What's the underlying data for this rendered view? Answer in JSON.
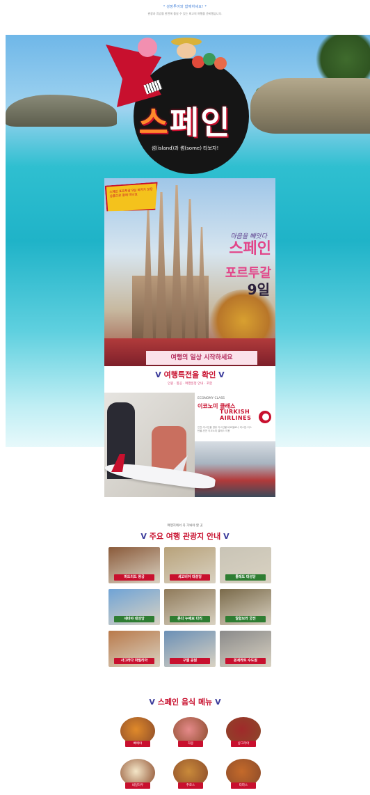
{
  "top": {
    "headline": "* 성장투어와 함께하세요! *",
    "subline": "관광과 휴양을 한번에 즐길 수 있는 최고의 여행을 준비했습니다."
  },
  "hero": {
    "title_first": "스",
    "title_rest": "페인",
    "subtitle": "섬(island)과 썸(some) 타보자!"
  },
  "poster": {
    "flag_text": "스페인 포르투갈 9일 최저가 보장 상품으로 함께 떠나요",
    "tagline": "마음을 빼앗다",
    "h1": "스페인",
    "h2": "포르투갈",
    "h3": "9일",
    "banner": "여행의 일상 시작하세요",
    "section_title": "여행특전을 확인",
    "section_small": "인원 · 항공 · 여행일정 안내 · 포함",
    "eco_label": "ECONOMY CLASS",
    "eco_kor": "이코노미 클래스",
    "airline_line1": "TURKISH",
    "airline_line2": "AIRLINES",
    "fine": "인천-이스탄불 경유 이스탄불-바르셀로나 리스본-이스탄불-인천 이코노미 클래스 이용"
  },
  "attractions": {
    "small": "여행지에서 꼭 가봐야 할 곳",
    "title": "주요 여행 관광지 안내",
    "v_left": "V",
    "v_right": "V",
    "items": [
      {
        "label": "마드리드 왕궁",
        "bg": "#8a5a3a",
        "lbl": "#c8102e"
      },
      {
        "label": "세고비아 대성당",
        "bg": "#b8a27a",
        "lbl": "#c8102e"
      },
      {
        "label": "톨레도 대성당",
        "bg": "#c9c4b6",
        "lbl": "#2e7d32"
      },
      {
        "label": "세비야 대성당",
        "bg": "#6fa3d6",
        "lbl": "#2e7d32"
      },
      {
        "label": "론다 누에보 다리",
        "bg": "#8f7a5a",
        "lbl": "#2e7d32"
      },
      {
        "label": "알함브라 궁전",
        "bg": "#7a6a4a",
        "lbl": "#2e7d32"
      },
      {
        "label": "사그라다 파밀리아",
        "bg": "#b9794a",
        "lbl": "#c8102e"
      },
      {
        "label": "구엘 공원",
        "bg": "#6a8fb6",
        "lbl": "#c8102e"
      },
      {
        "label": "몬세라트 수도원",
        "bg": "#8a8a8a",
        "lbl": "#c8102e"
      }
    ]
  },
  "foods": {
    "title": "스페인 음식 메뉴",
    "v_left": "V",
    "v_right": "V",
    "items": [
      {
        "label": "빠에야",
        "bg": "#e08a2a"
      },
      {
        "label": "하몽",
        "bg": "#e58a8a"
      },
      {
        "label": "상그리아",
        "bg": "#a02a2a"
      },
      {
        "label": "네일라우",
        "bg": "#f4e6c8"
      },
      {
        "label": "추로스",
        "bg": "#c98a3a"
      },
      {
        "label": "타파스",
        "bg": "#c46a2a"
      }
    ]
  }
}
